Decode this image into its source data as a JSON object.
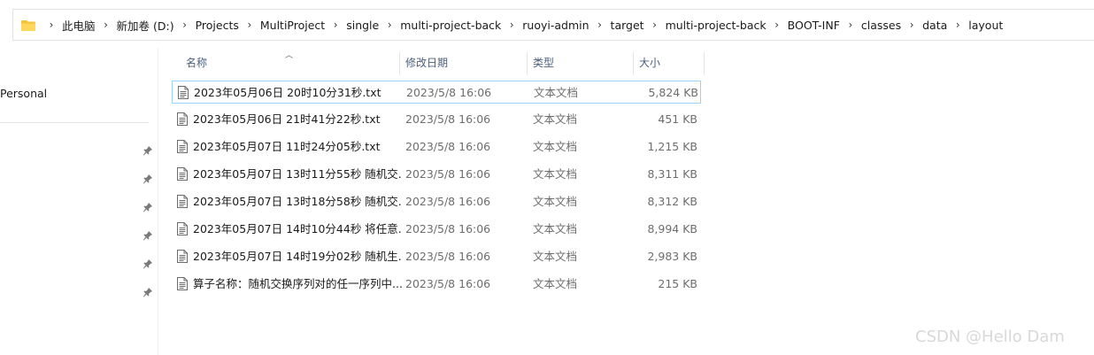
{
  "address": {
    "crumbs": [
      "此电脑",
      "新加卷 (D:)",
      "Projects",
      "MultiProject",
      "single",
      "multi-project-back",
      "ruoyi-admin",
      "target",
      "multi-project-back",
      "BOOT-INF",
      "classes",
      "data",
      "layout"
    ]
  },
  "sidebar": {
    "personal_label": "Personal",
    "pin_count": 6
  },
  "columns": {
    "name": "名称",
    "date": "修改日期",
    "type": "类型",
    "size": "大小"
  },
  "files": [
    {
      "name": "2023年05月06日 20时10分31秒.txt",
      "date": "2023/5/8 16:06",
      "type": "文本文档",
      "size": "5,824 KB",
      "selected": true
    },
    {
      "name": "2023年05月06日 21时41分22秒.txt",
      "date": "2023/5/8 16:06",
      "type": "文本文档",
      "size": "451 KB"
    },
    {
      "name": "2023年05月07日 11时24分05秒.txt",
      "date": "2023/5/8 16:06",
      "type": "文本文档",
      "size": "1,215 KB"
    },
    {
      "name": "2023年05月07日 13时11分55秒 随机交...",
      "date": "2023/5/8 16:06",
      "type": "文本文档",
      "size": "8,311 KB"
    },
    {
      "name": "2023年05月07日 13时18分58秒 随机交...",
      "date": "2023/5/8 16:06",
      "type": "文本文档",
      "size": "8,312 KB"
    },
    {
      "name": "2023年05月07日 14时10分44秒 将任意...",
      "date": "2023/5/8 16:06",
      "type": "文本文档",
      "size": "8,994 KB"
    },
    {
      "name": "2023年05月07日 14时19分02秒 随机生...",
      "date": "2023/5/8 16:06",
      "type": "文本文档",
      "size": "2,983 KB"
    },
    {
      "name": "算子名称：随机交换序列对的任一序列中...",
      "date": "2023/5/8 16:06",
      "type": "文本文档",
      "size": "215 KB"
    }
  ],
  "watermark": "CSDN @Hello Dam"
}
